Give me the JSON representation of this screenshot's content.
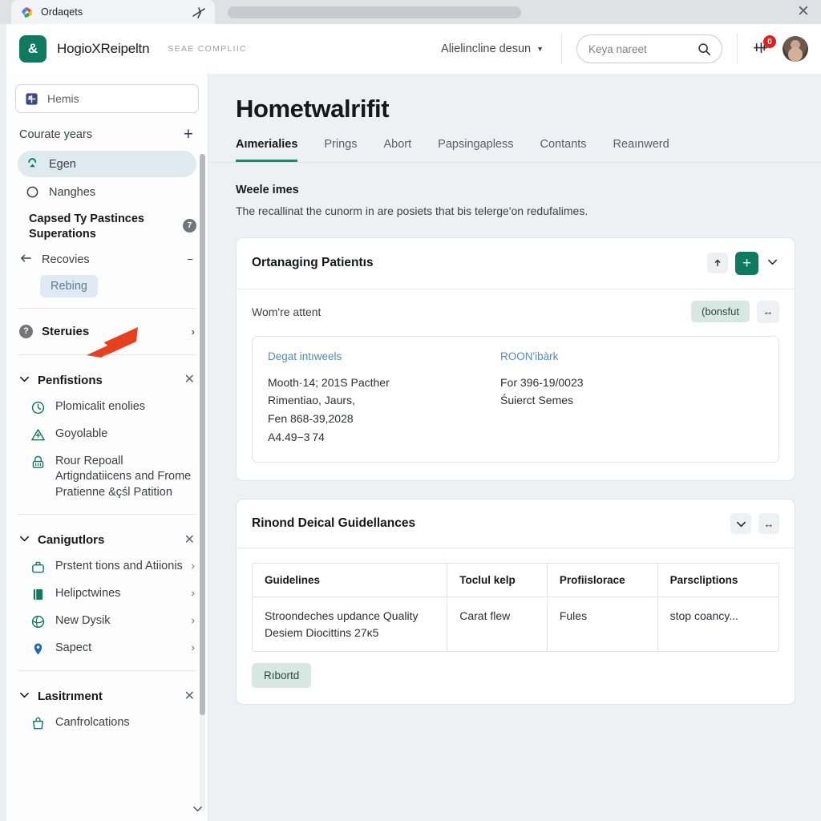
{
  "browser": {
    "tab_title": "Ordaqets",
    "close_label": "✕"
  },
  "appbar": {
    "logo_glyph": "&",
    "brand_name": "HogioXReipeltn",
    "brand_sub": "SEAE COMPLIIC",
    "org_selector": "Alielincline desun",
    "search_placeholder": "Keya nareet",
    "search_value": "",
    "notification_count": "0",
    "accent_color": "#0e7a60"
  },
  "sidebar": {
    "search_placeholder": "Hemis",
    "search_value": "",
    "section_label": "Courate years",
    "add_label": "+",
    "items": [
      {
        "label": "Egen",
        "icon": "sort-icon",
        "selected": true
      },
      {
        "label": "Nanghes",
        "icon": "circle-icon",
        "selected": false
      }
    ],
    "group_title": "Capsed Ty Pastinces Superations",
    "group_count": "7",
    "sub_label": "Recovies",
    "sub_collapse": "−",
    "leaf_label": "Rebing",
    "support_row": {
      "label": "Steruies",
      "icon": "help-icon",
      "chevron": "›"
    },
    "sections": [
      {
        "title": "Penfistions",
        "close": "✕",
        "items": [
          {
            "label": "Plomicalit enolies",
            "icon": "clock-icon",
            "chevron": ""
          },
          {
            "label": "Goyolable",
            "icon": "alert-triangle-icon",
            "chevron": ""
          },
          {
            "label": "Rour Repoall Artigndatiicens and Frome Pratienne &çśl Patition",
            "icon": "lock-icon",
            "chevron": ""
          }
        ]
      },
      {
        "title": "Canigutlors",
        "close": "✕",
        "items": [
          {
            "label": "Prstent tions and Atiionis",
            "icon": "briefcase-icon",
            "chevron": "›"
          },
          {
            "label": "Helipctwines",
            "icon": "book-icon",
            "chevron": "›"
          },
          {
            "label": "New Dysik",
            "icon": "globe-icon",
            "chevron": "›"
          },
          {
            "label": "Sapect",
            "icon": "map-pin-icon",
            "chevron": "›"
          }
        ]
      },
      {
        "title": "Lasitrıment",
        "close": "✕",
        "items": [
          {
            "label": "Canfrolcations",
            "icon": "bag-icon",
            "chevron": ""
          }
        ]
      }
    ]
  },
  "main": {
    "page_title": "Hometwalrifit",
    "tabs": [
      {
        "label": "Aımerialies",
        "active": true
      },
      {
        "label": "Prings",
        "active": false
      },
      {
        "label": "Abort",
        "active": false
      },
      {
        "label": "Papsingapless",
        "active": false
      },
      {
        "label": "Contants",
        "active": false
      },
      {
        "label": "Reaınwerd",
        "active": false
      }
    ],
    "section_label": "Weele imes",
    "section_desc": "The recallinat the cunorm in are posiets that bis telergeʹon redufalimes.",
    "card_one": {
      "title": "Ortanaging Patientıs",
      "action_upload": "⤒",
      "action_add": "+",
      "action_chevron": "⌄",
      "subrow_label": "Wom're attent",
      "subrow_chip": "(bonsfut",
      "subrow_expand": "↔",
      "columns": [
        {
          "head": "Degat intıweels",
          "lines": [
            "Mooth·14; 201S Pacther",
            "Rimentiao, Jaurs,",
            "Fen 868-39,2028",
            "A4.49−3 74"
          ]
        },
        {
          "head": "ROON'ibàrk",
          "lines": [
            "For 396-19/0023",
            "Śuierct Semes"
          ]
        }
      ]
    },
    "card_two": {
      "title": "Rinond Deical Guidellances",
      "action_chevron": "⌄",
      "action_expand": "↔",
      "table": {
        "headers": [
          "Guidelines",
          "Toclul kelp",
          "Profiislorace",
          "Parscliptions"
        ],
        "rows": [
          [
            "Stroondeches updance Quality Desiem Diocittins 27κ5",
            "Carat flew",
            "Fules",
            "stop coancy..."
          ]
        ]
      },
      "footer_chip": "Rıbortd"
    }
  }
}
